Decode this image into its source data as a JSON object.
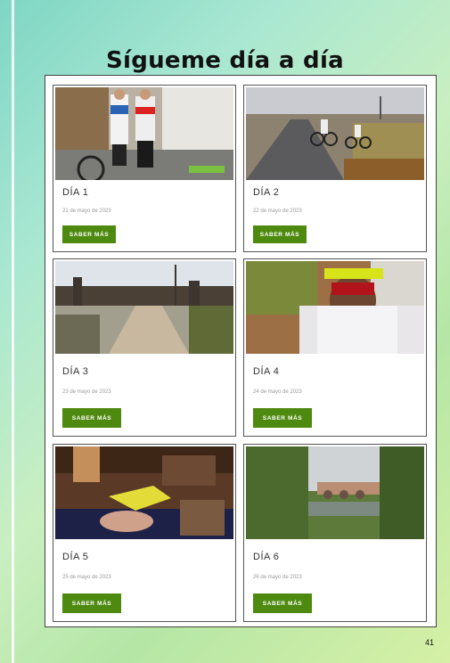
{
  "page": {
    "title": "Sígueme día a día",
    "page_number": "41"
  },
  "cards": [
    {
      "title": "DÍA 1",
      "date": "21 de mayo de 2023",
      "button": "SABER MÁS",
      "photo": "two-cyclists-in-front-of-building"
    },
    {
      "title": "DÍA 2",
      "date": "22 de mayo de 2023",
      "button": "SABER MÁS",
      "photo": "cyclists-on-rural-road"
    },
    {
      "title": "DÍA 3",
      "date": "23 de mayo de 2023",
      "button": "SABER MÁS",
      "photo": "castle-walls-and-dirt-road"
    },
    {
      "title": "DÍA 4",
      "date": "24 de mayo de 2023",
      "button": "SABER MÁS",
      "photo": "cyclist-selfie-with-helmet"
    },
    {
      "title": "DÍA 5",
      "date": "25 de mayo de 2023",
      "button": "SABER MÁS",
      "photo": "hand-holding-paper-in-restaurant"
    },
    {
      "title": "DÍA 6",
      "date": "26 de mayo de 2023",
      "button": "SABER MÁS",
      "photo": "stone-bridge-over-river"
    }
  ],
  "colors": {
    "button_green": "#4f8a10",
    "background_gradient": [
      "#7ed6c4",
      "#d6f0a6"
    ]
  }
}
